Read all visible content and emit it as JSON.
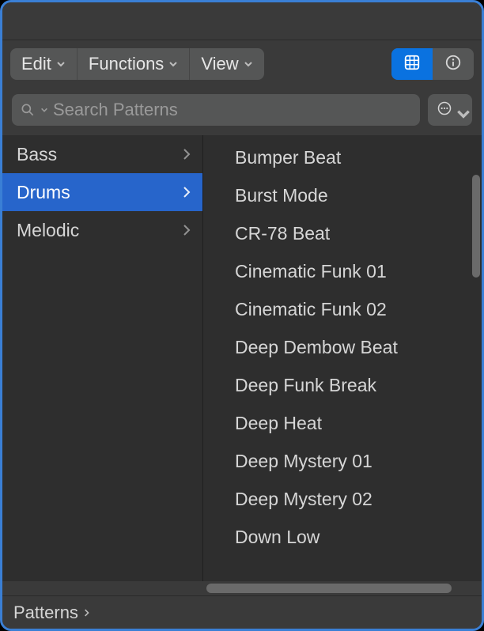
{
  "toolbar": {
    "edit_label": "Edit",
    "functions_label": "Functions",
    "view_label": "View"
  },
  "search": {
    "placeholder": "Search Patterns"
  },
  "categories": [
    {
      "label": "Bass",
      "selected": false
    },
    {
      "label": "Drums",
      "selected": true
    },
    {
      "label": "Melodic",
      "selected": false
    }
  ],
  "patterns": [
    "Bumper Beat",
    "Burst Mode",
    "CR-78 Beat",
    "Cinematic Funk 01",
    "Cinematic Funk 02",
    "Deep Dembow Beat",
    "Deep Funk Break",
    "Deep Heat",
    "Deep Mystery 01",
    "Deep Mystery 02",
    "Down Low"
  ],
  "footer": {
    "breadcrumb": "Patterns"
  }
}
